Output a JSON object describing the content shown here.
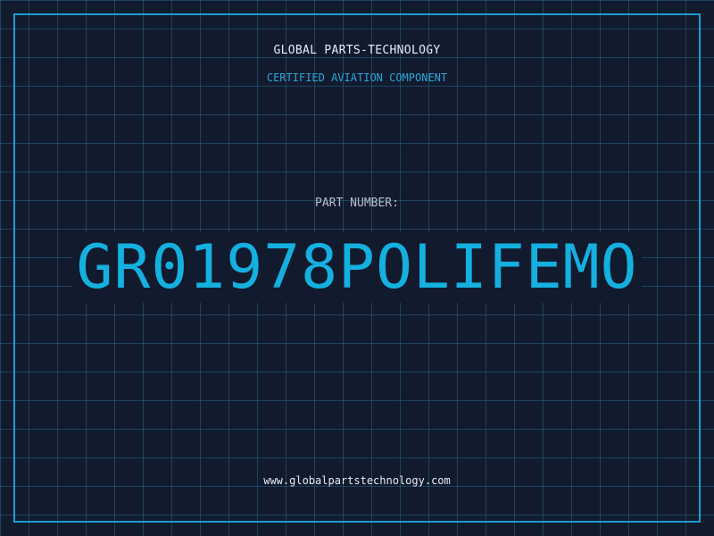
{
  "header": {
    "company": "GLOBAL PARTS-TECHNOLOGY",
    "subtitle": "CERTIFIED AVIATION COMPONENT"
  },
  "part": {
    "label": "PART NUMBER:",
    "number": "GR01978POLIFEMO"
  },
  "footer": {
    "website": "www.globalpartstechnology.com"
  },
  "colors": {
    "background": "#121a2e",
    "grid": "#28789a",
    "accent": "#14b0e0",
    "text": "#e6edf5"
  }
}
